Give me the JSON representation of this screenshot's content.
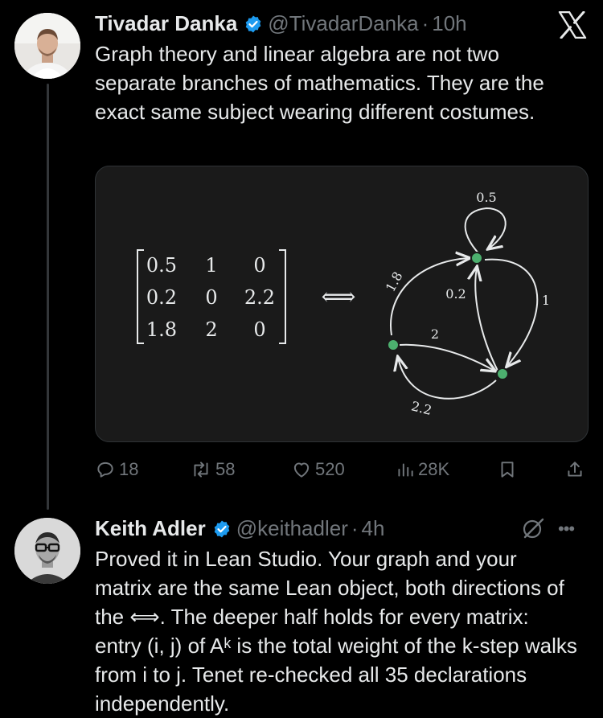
{
  "tweet": {
    "author_name": "Tivadar Danka",
    "handle": "@TivadarDanka",
    "separator": "·",
    "time": "10h",
    "text": "Graph theory and linear algebra are not two separate branches of mathematics. They are the exact same subject wearing different costumes.",
    "media": {
      "matrix": [
        [
          "0.5",
          "1",
          "0"
        ],
        [
          "0.2",
          "0",
          "2.2"
        ],
        [
          "1.8",
          "2",
          "0"
        ]
      ],
      "arrow_symbol": "⟺",
      "edge_labels": {
        "self_loop": "0.5",
        "left_to_top": "1.8",
        "right_to_top": "0.2",
        "top_to_right": "1",
        "left_to_right": "2",
        "right_to_left": "2.2"
      }
    },
    "stats": {
      "replies": "18",
      "reposts": "58",
      "likes": "520",
      "views": "28K"
    }
  },
  "reply": {
    "author_name": "Keith Adler",
    "handle": "@keithadler",
    "separator": "·",
    "time": "4h",
    "text": "Proved it in Lean Studio. Your graph and your matrix are the same Lean object, both directions of the ⟺. The deeper half holds for every matrix: entry (i, j) of Aᵏ is the total weight of the k-step walks from i to j. Tenet re-checked all 35 declarations independently."
  },
  "icons": {
    "verified": "verified-badge-icon",
    "brand": "x-logo-icon",
    "grok": "grok-icon",
    "more": "more-icon"
  },
  "colors": {
    "background": "#000000",
    "text": "#e7e9ea",
    "muted": "#71767b",
    "verified": "#1d9bf0",
    "node": "#4caf6e"
  }
}
